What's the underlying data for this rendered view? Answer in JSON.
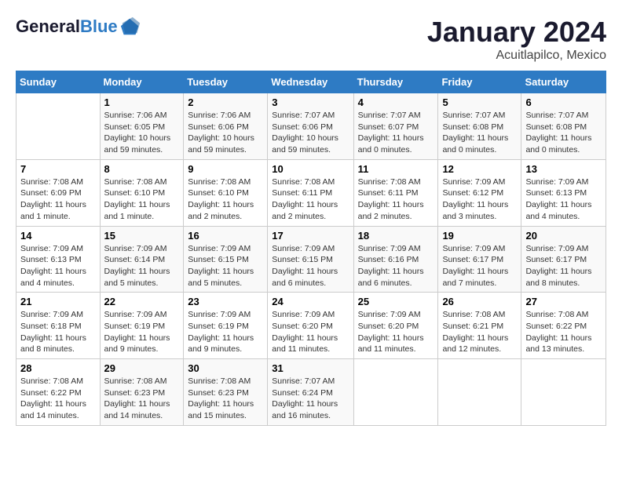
{
  "header": {
    "logo_line1": "General",
    "logo_line2": "Blue",
    "month": "January 2024",
    "location": "Acuitlapilco, Mexico"
  },
  "days_of_week": [
    "Sunday",
    "Monday",
    "Tuesday",
    "Wednesday",
    "Thursday",
    "Friday",
    "Saturday"
  ],
  "weeks": [
    [
      {
        "day": "",
        "info": ""
      },
      {
        "day": "1",
        "info": "Sunrise: 7:06 AM\nSunset: 6:05 PM\nDaylight: 10 hours\nand 59 minutes."
      },
      {
        "day": "2",
        "info": "Sunrise: 7:06 AM\nSunset: 6:06 PM\nDaylight: 10 hours\nand 59 minutes."
      },
      {
        "day": "3",
        "info": "Sunrise: 7:07 AM\nSunset: 6:06 PM\nDaylight: 10 hours\nand 59 minutes."
      },
      {
        "day": "4",
        "info": "Sunrise: 7:07 AM\nSunset: 6:07 PM\nDaylight: 11 hours\nand 0 minutes."
      },
      {
        "day": "5",
        "info": "Sunrise: 7:07 AM\nSunset: 6:08 PM\nDaylight: 11 hours\nand 0 minutes."
      },
      {
        "day": "6",
        "info": "Sunrise: 7:07 AM\nSunset: 6:08 PM\nDaylight: 11 hours\nand 0 minutes."
      }
    ],
    [
      {
        "day": "7",
        "info": "Sunrise: 7:08 AM\nSunset: 6:09 PM\nDaylight: 11 hours\nand 1 minute."
      },
      {
        "day": "8",
        "info": "Sunrise: 7:08 AM\nSunset: 6:10 PM\nDaylight: 11 hours\nand 1 minute."
      },
      {
        "day": "9",
        "info": "Sunrise: 7:08 AM\nSunset: 6:10 PM\nDaylight: 11 hours\nand 2 minutes."
      },
      {
        "day": "10",
        "info": "Sunrise: 7:08 AM\nSunset: 6:11 PM\nDaylight: 11 hours\nand 2 minutes."
      },
      {
        "day": "11",
        "info": "Sunrise: 7:08 AM\nSunset: 6:11 PM\nDaylight: 11 hours\nand 2 minutes."
      },
      {
        "day": "12",
        "info": "Sunrise: 7:09 AM\nSunset: 6:12 PM\nDaylight: 11 hours\nand 3 minutes."
      },
      {
        "day": "13",
        "info": "Sunrise: 7:09 AM\nSunset: 6:13 PM\nDaylight: 11 hours\nand 4 minutes."
      }
    ],
    [
      {
        "day": "14",
        "info": "Sunrise: 7:09 AM\nSunset: 6:13 PM\nDaylight: 11 hours\nand 4 minutes."
      },
      {
        "day": "15",
        "info": "Sunrise: 7:09 AM\nSunset: 6:14 PM\nDaylight: 11 hours\nand 5 minutes."
      },
      {
        "day": "16",
        "info": "Sunrise: 7:09 AM\nSunset: 6:15 PM\nDaylight: 11 hours\nand 5 minutes."
      },
      {
        "day": "17",
        "info": "Sunrise: 7:09 AM\nSunset: 6:15 PM\nDaylight: 11 hours\nand 6 minutes."
      },
      {
        "day": "18",
        "info": "Sunrise: 7:09 AM\nSunset: 6:16 PM\nDaylight: 11 hours\nand 6 minutes."
      },
      {
        "day": "19",
        "info": "Sunrise: 7:09 AM\nSunset: 6:17 PM\nDaylight: 11 hours\nand 7 minutes."
      },
      {
        "day": "20",
        "info": "Sunrise: 7:09 AM\nSunset: 6:17 PM\nDaylight: 11 hours\nand 8 minutes."
      }
    ],
    [
      {
        "day": "21",
        "info": "Sunrise: 7:09 AM\nSunset: 6:18 PM\nDaylight: 11 hours\nand 8 minutes."
      },
      {
        "day": "22",
        "info": "Sunrise: 7:09 AM\nSunset: 6:19 PM\nDaylight: 11 hours\nand 9 minutes."
      },
      {
        "day": "23",
        "info": "Sunrise: 7:09 AM\nSunset: 6:19 PM\nDaylight: 11 hours\nand 9 minutes."
      },
      {
        "day": "24",
        "info": "Sunrise: 7:09 AM\nSunset: 6:20 PM\nDaylight: 11 hours\nand 11 minutes."
      },
      {
        "day": "25",
        "info": "Sunrise: 7:09 AM\nSunset: 6:20 PM\nDaylight: 11 hours\nand 11 minutes."
      },
      {
        "day": "26",
        "info": "Sunrise: 7:08 AM\nSunset: 6:21 PM\nDaylight: 11 hours\nand 12 minutes."
      },
      {
        "day": "27",
        "info": "Sunrise: 7:08 AM\nSunset: 6:22 PM\nDaylight: 11 hours\nand 13 minutes."
      }
    ],
    [
      {
        "day": "28",
        "info": "Sunrise: 7:08 AM\nSunset: 6:22 PM\nDaylight: 11 hours\nand 14 minutes."
      },
      {
        "day": "29",
        "info": "Sunrise: 7:08 AM\nSunset: 6:23 PM\nDaylight: 11 hours\nand 14 minutes."
      },
      {
        "day": "30",
        "info": "Sunrise: 7:08 AM\nSunset: 6:23 PM\nDaylight: 11 hours\nand 15 minutes."
      },
      {
        "day": "31",
        "info": "Sunrise: 7:07 AM\nSunset: 6:24 PM\nDaylight: 11 hours\nand 16 minutes."
      },
      {
        "day": "",
        "info": ""
      },
      {
        "day": "",
        "info": ""
      },
      {
        "day": "",
        "info": ""
      }
    ]
  ]
}
